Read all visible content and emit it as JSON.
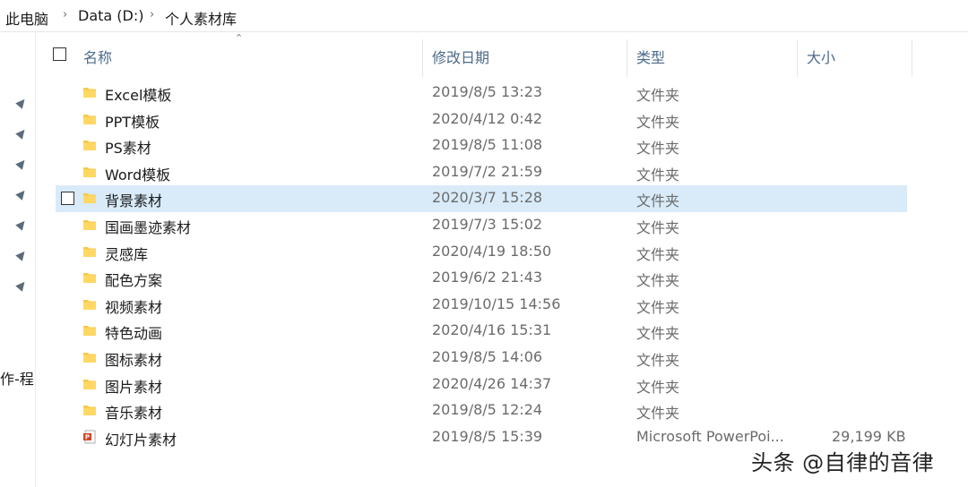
{
  "breadcrumb": [
    "此电脑",
    "Data (D:)",
    "个人素材库"
  ],
  "columns": {
    "name": "名称",
    "date": "修改日期",
    "type": "类型",
    "size": "大小"
  },
  "nav": {
    "cut_label": "作-程"
  },
  "files": [
    {
      "name": "Excel模板",
      "date": "2019/8/5 13:23",
      "type": "文件夹",
      "size": "",
      "icon": "folder-icon"
    },
    {
      "name": "PPT模板",
      "date": "2020/4/12 0:42",
      "type": "文件夹",
      "size": "",
      "icon": "folder-icon"
    },
    {
      "name": "PS素材",
      "date": "2019/8/5 11:08",
      "type": "文件夹",
      "size": "",
      "icon": "folder-icon"
    },
    {
      "name": "Word模板",
      "date": "2019/7/2 21:59",
      "type": "文件夹",
      "size": "",
      "icon": "folder-icon"
    },
    {
      "name": "背景素材",
      "date": "2020/3/7 15:28",
      "type": "文件夹",
      "size": "",
      "icon": "folder-icon",
      "selected": true
    },
    {
      "name": "国画墨迹素材",
      "date": "2019/7/3 15:02",
      "type": "文件夹",
      "size": "",
      "icon": "folder-icon"
    },
    {
      "name": "灵感库",
      "date": "2020/4/19 18:50",
      "type": "文件夹",
      "size": "",
      "icon": "folder-icon"
    },
    {
      "name": "配色方案",
      "date": "2019/6/2 21:43",
      "type": "文件夹",
      "size": "",
      "icon": "folder-icon"
    },
    {
      "name": "视频素材",
      "date": "2019/10/15 14:56",
      "type": "文件夹",
      "size": "",
      "icon": "folder-icon"
    },
    {
      "name": "特色动画",
      "date": "2020/4/16 15:31",
      "type": "文件夹",
      "size": "",
      "icon": "folder-icon"
    },
    {
      "name": "图标素材",
      "date": "2019/8/5 14:06",
      "type": "文件夹",
      "size": "",
      "icon": "folder-icon"
    },
    {
      "name": "图片素材",
      "date": "2020/4/26 14:37",
      "type": "文件夹",
      "size": "",
      "icon": "folder-icon"
    },
    {
      "name": "音乐素材",
      "date": "2019/8/5 12:24",
      "type": "文件夹",
      "size": "",
      "icon": "folder-icon"
    },
    {
      "name": "幻灯片素材",
      "date": "2019/8/5 15:39",
      "type": "Microsoft PowerPoi...",
      "size": "29,199 KB",
      "icon": "powerpoint-file-icon"
    }
  ],
  "colors": {
    "folder": "#f7c948",
    "selection": "#d9ebf9",
    "header_text": "#4d6b8a",
    "ppt": "#d24726"
  },
  "watermark": "头条 @自律的音律"
}
